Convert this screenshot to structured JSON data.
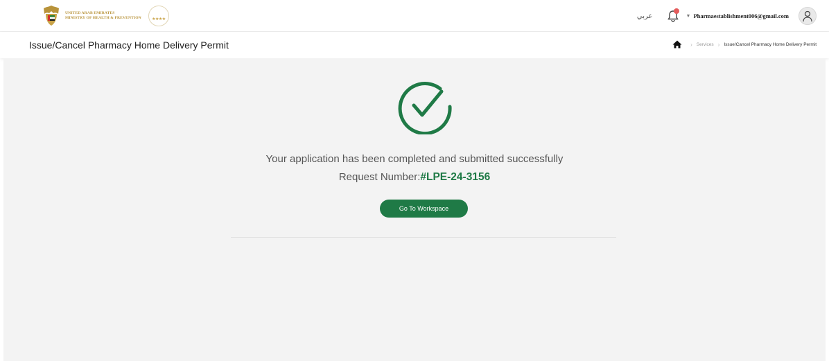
{
  "header": {
    "ministry_line1": "UNITED ARAB EMIRATES",
    "ministry_line2": "MINISTRY OF HEALTH & PREVENTION",
    "language_toggle": "عربي",
    "user_email": "Pharmaestablishment006@gmail.com",
    "icons": [
      "uae-emblem-icon",
      "stars-rating-icon",
      "bell-icon",
      "chevron-down-icon",
      "avatar-icon"
    ]
  },
  "subheader": {
    "page_title": "Issue/Cancel Pharmacy Home Delivery Permit",
    "breadcrumb": {
      "services": "Services",
      "current": "Issue/Cancel Pharmacy Home Delivery Permit"
    }
  },
  "main": {
    "success_message": "Your application has been completed and submitted successfully",
    "request_label": "Request Number:",
    "request_number": "#LPE-24-3156",
    "workspace_button": "Go To Workspace"
  },
  "colors": {
    "brand_green": "#1f7a46",
    "gold": "#b8933a",
    "background": "#f3f3f3",
    "notification": "#e45c5c"
  }
}
